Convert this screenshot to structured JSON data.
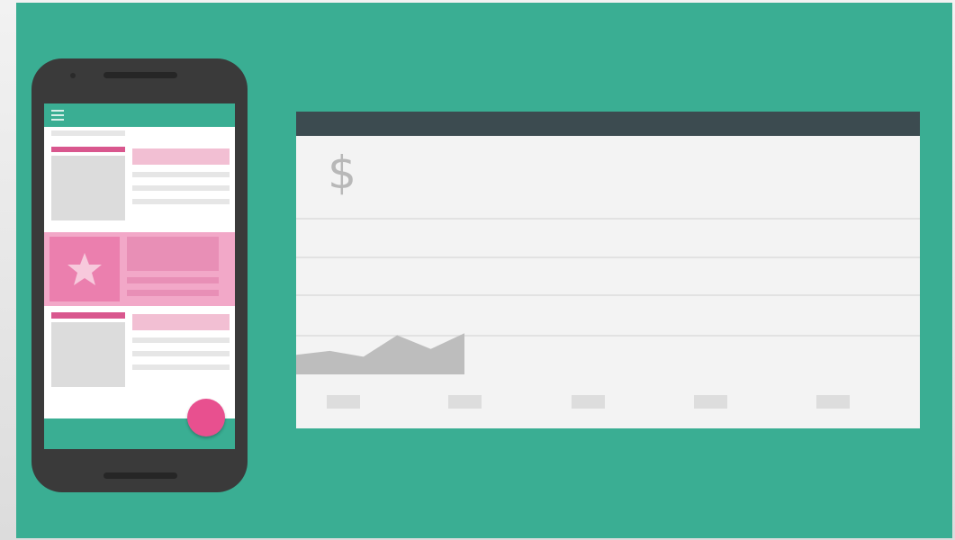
{
  "scene": {
    "background_color": "#3aae93",
    "accent_pink": "#e8508f",
    "header_color": "#3c4b50"
  },
  "phone": {
    "menu_icon": "hamburger-menu-icon",
    "highlight_icon": "star-icon",
    "fab_icon": "circle-fab"
  },
  "revenue_card": {
    "currency_symbol": "$",
    "area_chart": {
      "type": "area",
      "values": [
        1.0,
        1.2,
        0.9,
        2.0,
        1.3,
        2.1
      ],
      "ylim": [
        0,
        8
      ],
      "color": "#bdbdbd"
    },
    "x_ticks": 5
  }
}
